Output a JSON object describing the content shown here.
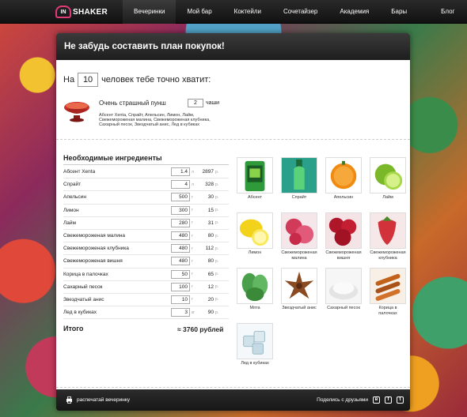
{
  "header": {
    "logo_in": "IN",
    "logo_brand": "SHAKER",
    "nav": [
      "Вечеринки",
      "Мой бар",
      "Коктейли",
      "Сочетайзер",
      "Академия",
      "Бары",
      "Блог"
    ]
  },
  "page": {
    "title": "Не забудь составить план покупок!",
    "people_prefix": "На",
    "people_count": "10",
    "people_suffix": "человек тебе точно хватит:"
  },
  "order": {
    "drink_name": "Очень страшный пунш",
    "portions": "2",
    "portions_unit": "чаши",
    "composition": "Абсент Xenta, Спрайт, Апельсин, Лимон, Лайм, Свежемороженая малина, Свежемороженая клубника, Сахарный песок, Звездчатый анис, Лед в кубиках"
  },
  "ingredients": {
    "title": "Необходимые ингредиенты",
    "rows": [
      {
        "name": "Абсент Xenta",
        "amount": "1.4",
        "unit": "л",
        "price": "2897",
        "price_unit": "р."
      },
      {
        "name": "Спрайт",
        "amount": "4",
        "unit": "л",
        "price": "328",
        "price_unit": "р."
      },
      {
        "name": "Апельсин",
        "amount": "500",
        "unit": "г",
        "price": "30",
        "price_unit": "р."
      },
      {
        "name": "Лимон",
        "amount": "300",
        "unit": "г",
        "price": "15",
        "price_unit": "р."
      },
      {
        "name": "Лайм",
        "amount": "280",
        "unit": "г",
        "price": "31",
        "price_unit": "р."
      },
      {
        "name": "Свежемороженая малина",
        "amount": "480",
        "unit": "г",
        "price": "80",
        "price_unit": "р."
      },
      {
        "name": "Свежемороженая клубника",
        "amount": "480",
        "unit": "г",
        "price": "112",
        "price_unit": "р."
      },
      {
        "name": "Свежемороженая вишня",
        "amount": "480",
        "unit": "г",
        "price": "80",
        "price_unit": "р."
      },
      {
        "name": "Корица в палочках",
        "amount": "50",
        "unit": "г",
        "price": "65",
        "price_unit": "р."
      },
      {
        "name": "Сахарный песок",
        "amount": "100",
        "unit": "г",
        "price": "12",
        "price_unit": "р."
      },
      {
        "name": "Звездчатый анис",
        "amount": "10",
        "unit": "г",
        "price": "20",
        "price_unit": "р."
      },
      {
        "name": "Лед в кубиках",
        "amount": "3",
        "unit": "кг",
        "price": "90",
        "price_unit": "р."
      }
    ],
    "total_label": "Итого",
    "total_value": "≈ 3760 рублей"
  },
  "tiles": [
    {
      "label": "Абсент",
      "color": "#2e9a3a",
      "icon": "absinthe-bottle-icon"
    },
    {
      "label": "Спрайт",
      "color": "#3cb06a",
      "icon": "sprite-bottle-icon"
    },
    {
      "label": "Апельсин",
      "color": "#f08a10",
      "icon": "orange-icon"
    },
    {
      "label": "Лайм",
      "color": "#7ab82a",
      "icon": "lime-icon"
    },
    {
      "label": "Лимон",
      "color": "#f2d21a",
      "icon": "lemon-icon"
    },
    {
      "label": "Свежемороженая малина",
      "color": "#d23a5a",
      "icon": "raspberry-icon"
    },
    {
      "label": "Свежемороженая вишня",
      "color": "#b0162a",
      "icon": "cherry-icon"
    },
    {
      "label": "Свежемороженая клубника",
      "color": "#d2323a",
      "icon": "strawberry-icon"
    },
    {
      "label": "Мята",
      "color": "#4aa04a",
      "icon": "mint-icon"
    },
    {
      "label": "Звездчатый анис",
      "color": "#8a4a22",
      "icon": "star-anise-icon"
    },
    {
      "label": "Сахарный песок",
      "color": "#eeeeee",
      "icon": "sugar-icon"
    },
    {
      "label": "Корица в палочках",
      "color": "#c2621a",
      "icon": "cinnamon-icon"
    },
    {
      "label": "Лед в кубиках",
      "color": "#d6e8ef",
      "icon": "ice-cubes-icon"
    }
  ],
  "footer": {
    "print_label": "распечатай вечеринку",
    "share_label": "Поделись с друзьями"
  }
}
